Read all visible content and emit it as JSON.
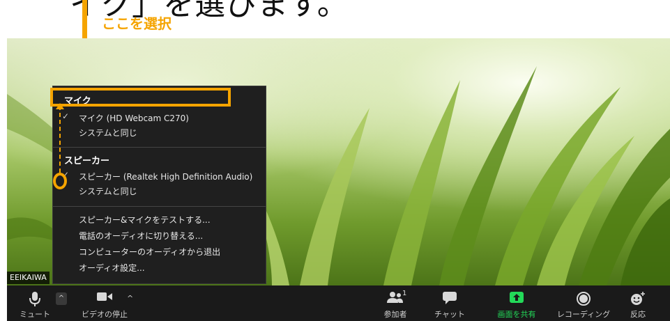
{
  "heading": {
    "text": "イク」を選びます。"
  },
  "callout": {
    "label": "ここを選択"
  },
  "video": {
    "participant_name": "EEIKAIWA"
  },
  "menu": {
    "mic_header": "マイク",
    "mic_selected": "マイク (HD Webcam C270)",
    "mic_same_as_system": "システムと同じ",
    "speaker_header": "スピーカー",
    "speaker_selected": "スピーカー (Realtek High Definition Audio)",
    "speaker_same_as_system": "システムと同じ",
    "test_speaker_mic": "スピーカー&マイクをテストする...",
    "switch_to_phone": "電話のオーディオに切り替える...",
    "leave_computer_audio": "コンピューターのオーディオから退出",
    "audio_settings": "オーディオ設定...",
    "check_mark": "✓"
  },
  "toolbar": {
    "mute_label": "ミュート",
    "stop_video_label": "ビデオの停止",
    "participants_label": "参加者",
    "participants_count": "1",
    "chat_label": "チャット",
    "share_screen_label": "画面を共有",
    "record_label": "レコーディング",
    "reactions_label": "反応",
    "caret": "^"
  },
  "colors": {
    "callout": "#f5a400",
    "share_green": "#23d959",
    "toolbar_bg": "#1a1a1a",
    "menu_bg": "#1f1f1f"
  }
}
